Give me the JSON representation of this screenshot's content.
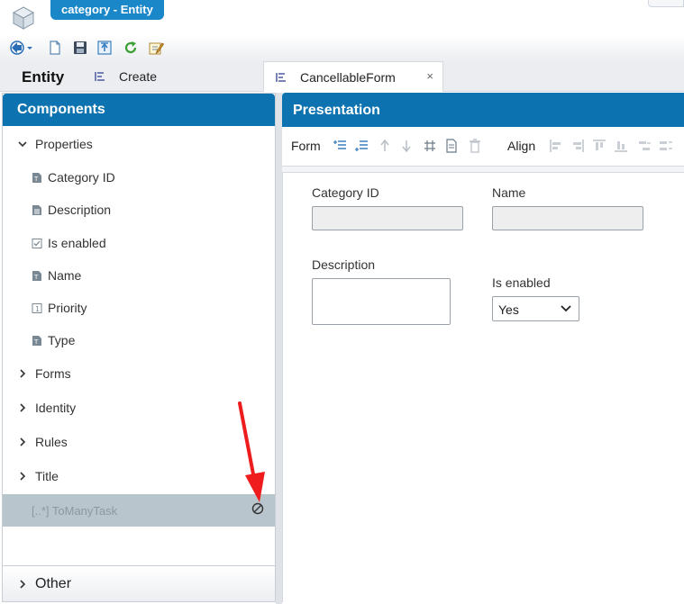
{
  "window": {
    "title": "category - Entity"
  },
  "tabs": {
    "entity": "Entity",
    "create": "Create",
    "form": "CancellableForm",
    "close_glyph": "×"
  },
  "components": {
    "header": "Components",
    "properties_label": "Properties",
    "properties": [
      {
        "label": "Category ID",
        "icon": "text-field-icon"
      },
      {
        "label": "Description",
        "icon": "document-field-icon"
      },
      {
        "label": "Is enabled",
        "icon": "checkbox-field-icon"
      },
      {
        "label": "Name",
        "icon": "text-field-icon"
      },
      {
        "label": "Priority",
        "icon": "number-field-icon"
      },
      {
        "label": "Type",
        "icon": "text-field-icon"
      }
    ],
    "groups": [
      "Forms",
      "Identity",
      "Rules",
      "Title"
    ],
    "disabled_item": "[..*] ToManyTask",
    "other": "Other"
  },
  "presentation": {
    "header": "Presentation",
    "form_label": "Form",
    "align_label": "Align",
    "fields": {
      "category_id_label": "Category ID",
      "name_label": "Name",
      "description_label": "Description",
      "is_enabled_label": "Is enabled",
      "is_enabled_value": "Yes"
    }
  },
  "colors": {
    "header_blue": "#0d73b0",
    "title_tab_blue": "#1a87c8",
    "disabled_row": "#b9c5cc",
    "annotation_arrow": "#ee1c1c"
  }
}
